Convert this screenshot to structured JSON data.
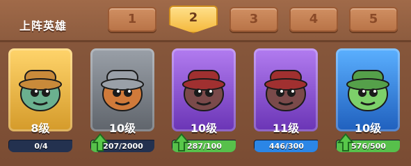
{
  "header": {
    "title": "上阵英雄",
    "tabs": [
      "1",
      "2",
      "3",
      "4",
      "5"
    ],
    "active_tab": 1
  },
  "heroes": [
    {
      "level": "8级",
      "progress_text": "0/4",
      "progress": 0.0,
      "theme": "gold",
      "upgradable": false
    },
    {
      "level": "10级",
      "progress_text": "207/2000",
      "progress": 0.1035,
      "theme": "gray",
      "upgradable": true
    },
    {
      "level": "10级",
      "progress_text": "287/100",
      "progress": 1.0,
      "theme": "purple",
      "upgradable": true
    },
    {
      "level": "11级",
      "progress_text": "446/300",
      "progress": 1.0,
      "theme": "purple",
      "upgradable": false
    },
    {
      "level": "10级",
      "progress_text": "576/500",
      "progress": 1.0,
      "theme": "blue",
      "upgradable": true
    }
  ],
  "colors": {
    "gold": "#f0b24a",
    "gray": "#7a7f86",
    "purple": "#8a4fd1",
    "blue": "#2d7fe0",
    "fill_green": "#57c04b",
    "fill_blue": "#2b86e6"
  }
}
